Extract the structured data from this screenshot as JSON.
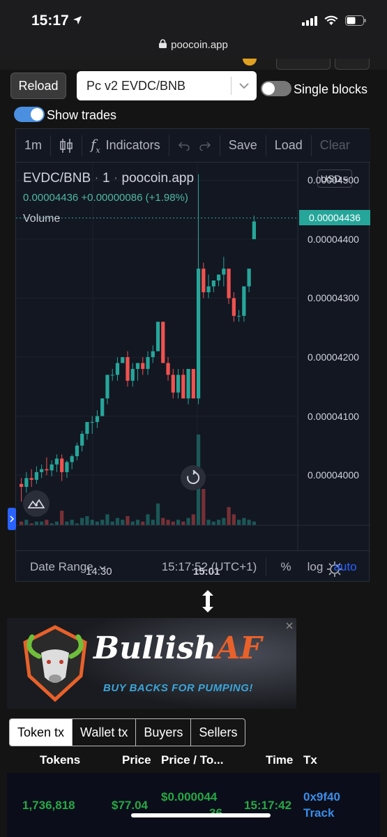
{
  "status": {
    "time": "15:17"
  },
  "browser": {
    "url": "poocoin.app"
  },
  "controls": {
    "reload_label": "Reload",
    "pair_selected": "Pc v2 EVDC/BNB",
    "single_blocks_label": "Single blocks",
    "show_trades_label": "Show trades",
    "single_blocks_on": false,
    "show_trades_on": true
  },
  "chart_toolbar": {
    "interval": "1m",
    "indicators_label": "Indicators",
    "save_label": "Save",
    "load_label": "Load",
    "clear_label": "Clear"
  },
  "chart_legend": {
    "pair": "EVDC/BNB",
    "interval": "1",
    "source": "poocoin.app",
    "last": "0.00004436",
    "change": "+0.00000086",
    "change_pct": "(+1.98%)",
    "volume_label": "Volume",
    "currency_button": "USD"
  },
  "chart_footer": {
    "date_range_label": "Date Range",
    "clock": "15:17:52 (UTC+1)",
    "percent_label": "%",
    "log_label": "log",
    "auto_label": "auto"
  },
  "chart_data": {
    "type": "candlestick",
    "y_ticks": [
      "0.00004500",
      "0.00004400",
      "0.00004300",
      "0.00004200",
      "0.00004100",
      "0.00004000"
    ],
    "y_tick_values": [
      4.5e-05,
      4.4e-05,
      4.3e-05,
      4.2e-05,
      4.1e-05,
      4e-05
    ],
    "x_ticks": [
      "14:30",
      "15:01"
    ],
    "last_price_label": "0.00004436",
    "last_price": 4.436e-05,
    "ylim": [
      3.915e-05,
      4.53e-05
    ],
    "colors": {
      "up": "#26a69a",
      "down": "#ef5350"
    },
    "candles": [
      {
        "o": 3.985e-05,
        "h": 3.995e-05,
        "l": 3.955e-05,
        "c": 3.98e-05
      },
      {
        "o": 3.98e-05,
        "h": 4.005e-05,
        "l": 3.97e-05,
        "c": 3.995e-05
      },
      {
        "o": 3.995e-05,
        "h": 4.01e-05,
        "l": 3.98e-05,
        "c": 3.992e-05
      },
      {
        "o": 3.992e-05,
        "h": 4.015e-05,
        "l": 3.985e-05,
        "c": 4.005e-05
      },
      {
        "o": 4.005e-05,
        "h": 4.018e-05,
        "l": 3.995e-05,
        "c": 4.01e-05
      },
      {
        "o": 4.01e-05,
        "h": 4.03e-05,
        "l": 4e-05,
        "c": 4.008e-05
      },
      {
        "o": 4.008e-05,
        "h": 4.025e-05,
        "l": 3.998e-05,
        "c": 4.018e-05
      },
      {
        "o": 4.018e-05,
        "h": 4.035e-05,
        "l": 4.005e-05,
        "c": 4.028e-05
      },
      {
        "o": 4.028e-05,
        "h": 4.035e-05,
        "l": 3.99e-05,
        "c": 4.005e-05
      },
      {
        "o": 4.005e-05,
        "h": 4.025e-05,
        "l": 3.995e-05,
        "c": 4.022e-05
      },
      {
        "o": 4.022e-05,
        "h": 4.035e-05,
        "l": 4.01e-05,
        "c": 4.032e-05
      },
      {
        "o": 4.032e-05,
        "h": 4.055e-05,
        "l": 4.025e-05,
        "c": 4.05e-05
      },
      {
        "o": 4.05e-05,
        "h": 4.075e-05,
        "l": 4.04e-05,
        "c": 4.07e-05
      },
      {
        "o": 4.07e-05,
        "h": 4.09e-05,
        "l": 4.06e-05,
        "c": 4.09e-05
      },
      {
        "o": 4.09e-05,
        "h": 4.1e-05,
        "l": 4.07e-05,
        "c": 4.09e-05
      },
      {
        "o": 4.09e-05,
        "h": 4.11e-05,
        "l": 4.08e-05,
        "c": 4.1e-05
      },
      {
        "o": 4.1e-05,
        "h": 4.13e-05,
        "l": 4.1e-05,
        "c": 4.13e-05
      },
      {
        "o": 4.13e-05,
        "h": 4.17e-05,
        "l": 4.12e-05,
        "c": 4.17e-05
      },
      {
        "o": 4.17e-05,
        "h": 4.18e-05,
        "l": 4.16e-05,
        "c": 4.17e-05
      },
      {
        "o": 4.17e-05,
        "h": 4.2e-05,
        "l": 4.16e-05,
        "c": 4.19e-05
      },
      {
        "o": 4.19e-05,
        "h": 4.2e-05,
        "l": 4.19e-05,
        "c": 4.2e-05
      },
      {
        "o": 4.2e-05,
        "h": 4.21e-05,
        "l": 4.15e-05,
        "c": 4.16e-05
      },
      {
        "o": 4.16e-05,
        "h": 4.19e-05,
        "l": 4.15e-05,
        "c": 4.18e-05
      },
      {
        "o": 4.18e-05,
        "h": 4.19e-05,
        "l": 4.16e-05,
        "c": 4.19e-05
      },
      {
        "o": 4.19e-05,
        "h": 4.2e-05,
        "l": 4.17e-05,
        "c": 4.18e-05
      },
      {
        "o": 4.18e-05,
        "h": 4.21e-05,
        "l": 4.17e-05,
        "c": 4.2e-05
      },
      {
        "o": 4.2e-05,
        "h": 4.22e-05,
        "l": 4.19e-05,
        "c": 4.21e-05
      },
      {
        "o": 4.21e-05,
        "h": 4.26e-05,
        "l": 4.21e-05,
        "c": 4.26e-05
      },
      {
        "o": 4.26e-05,
        "h": 4.26e-05,
        "l": 4.19e-05,
        "c": 4.19e-05
      },
      {
        "o": 4.19e-05,
        "h": 4.2e-05,
        "l": 4.16e-05,
        "c": 4.17e-05
      },
      {
        "o": 4.17e-05,
        "h": 4.18e-05,
        "l": 4.13e-05,
        "c": 4.14e-05
      },
      {
        "o": 4.14e-05,
        "h": 4.18e-05,
        "l": 4.13e-05,
        "c": 4.17e-05
      },
      {
        "o": 4.17e-05,
        "h": 4.18e-05,
        "l": 4.13e-05,
        "c": 4.13e-05
      },
      {
        "o": 4.13e-05,
        "h": 4.18e-05,
        "l": 4.12e-05,
        "c": 4.18e-05
      },
      {
        "o": 4.18e-05,
        "h": 4.18e-05,
        "l": 4.13e-05,
        "c": 4.13e-05
      },
      {
        "o": 4.13e-05,
        "h": 4.51e-05,
        "l": 4.12e-05,
        "c": 4.35e-05
      },
      {
        "o": 4.35e-05,
        "h": 4.36e-05,
        "l": 4.3e-05,
        "c": 4.31e-05
      },
      {
        "o": 4.31e-05,
        "h": 4.34e-05,
        "l": 4.3e-05,
        "c": 4.32e-05
      },
      {
        "o": 4.32e-05,
        "h": 4.33e-05,
        "l": 4.31e-05,
        "c": 4.33e-05
      },
      {
        "o": 4.33e-05,
        "h": 4.34e-05,
        "l": 4.32e-05,
        "c": 4.34e-05
      },
      {
        "o": 4.34e-05,
        "h": 4.37e-05,
        "l": 4.32e-05,
        "c": 4.35e-05
      },
      {
        "o": 4.35e-05,
        "h": 4.35e-05,
        "l": 4.29e-05,
        "c": 4.3e-05
      },
      {
        "o": 4.3e-05,
        "h": 4.31e-05,
        "l": 4.26e-05,
        "c": 4.27e-05
      },
      {
        "o": 4.27e-05,
        "h": 4.28e-05,
        "l": 4.26e-05,
        "c": 4.27e-05
      },
      {
        "o": 4.27e-05,
        "h": 4.32e-05,
        "l": 4.26e-05,
        "c": 4.32e-05
      },
      {
        "o": 4.32e-05,
        "h": 4.35e-05,
        "l": 4.31e-05,
        "c": 4.35e-05
      },
      {
        "o": 4.4e-05,
        "h": 4.44e-05,
        "l": 4.4e-05,
        "c": 4.43e-05
      }
    ],
    "volumes": [
      2,
      3,
      1,
      2,
      2,
      3,
      1,
      2,
      8,
      2,
      3,
      1,
      4,
      5,
      3,
      2,
      3,
      6,
      2,
      4,
      3,
      5,
      2,
      3,
      2,
      6,
      3,
      12,
      4,
      3,
      2,
      3,
      2,
      4,
      6,
      50,
      20,
      3,
      2,
      3,
      4,
      10,
      6,
      3,
      4,
      3,
      2
    ]
  },
  "banner": {
    "title_main": "Bullish",
    "title_accent": "AF",
    "subtitle": "BUY BACKS FOR PUMPING!"
  },
  "tx_tabs": [
    "Token tx",
    "Wallet tx",
    "Buyers",
    "Sellers"
  ],
  "tx_table": {
    "headers": [
      "Tokens",
      "Price",
      "Price / To...",
      "Time",
      "Tx"
    ],
    "row": {
      "tokens": "1,736,818",
      "price": "$77.04",
      "price_per_token_line1": "$0.000044",
      "price_per_token_line2": "36",
      "time": "15:17:42",
      "tx": "0x9f40",
      "track": "Track"
    }
  }
}
